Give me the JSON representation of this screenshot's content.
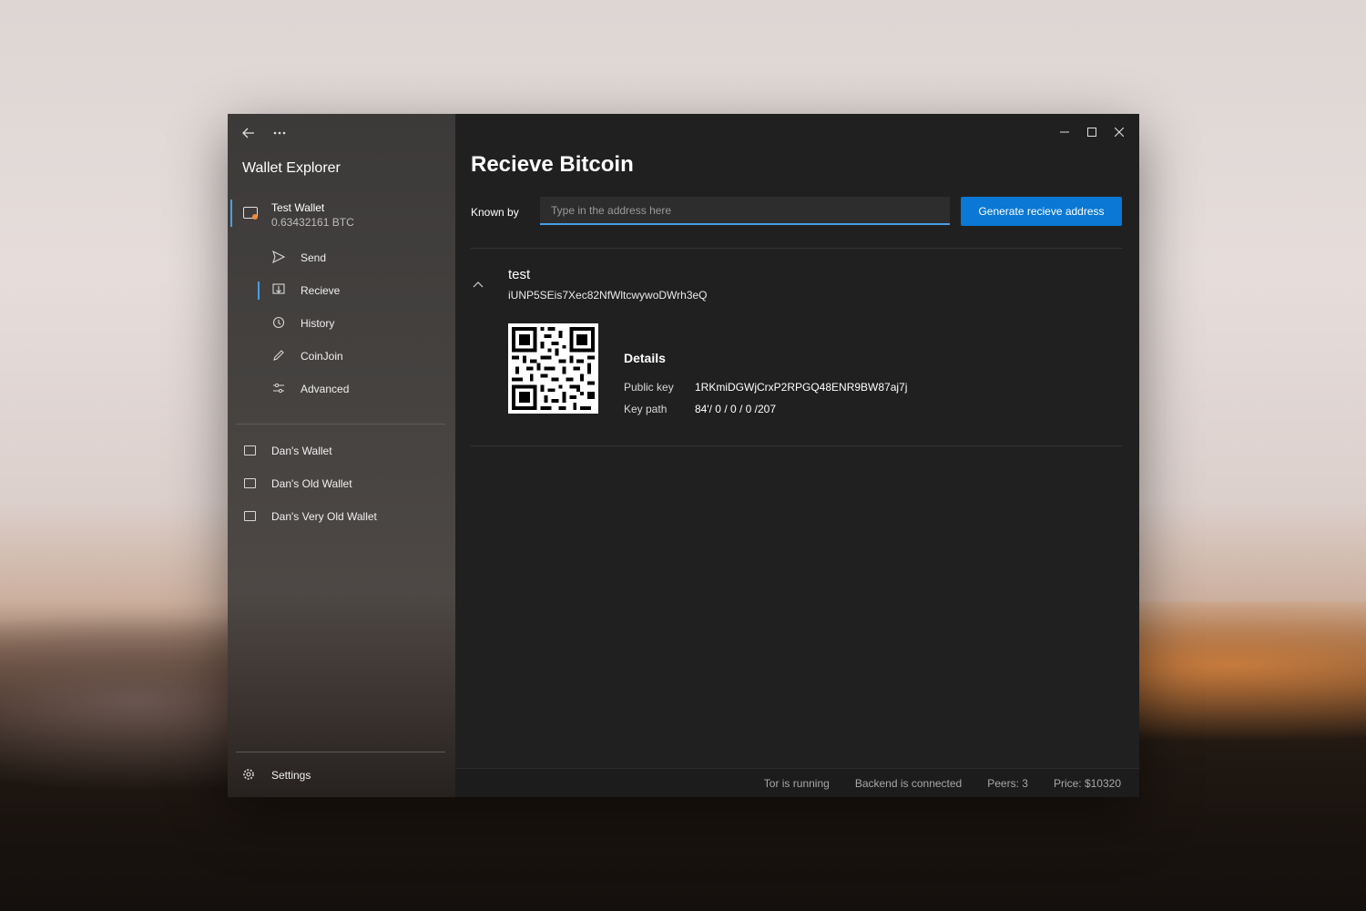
{
  "sidebar": {
    "app_title": "Wallet Explorer",
    "active_wallet": {
      "name": "Test Wallet",
      "balance": "0.63432161 BTC"
    },
    "nav": [
      {
        "label": "Send",
        "icon": "send-icon"
      },
      {
        "label": "Recieve",
        "icon": "receive-icon",
        "active": true
      },
      {
        "label": "History",
        "icon": "history-icon"
      },
      {
        "label": "CoinJoin",
        "icon": "pen-icon"
      },
      {
        "label": "Advanced",
        "icon": "sliders-icon"
      }
    ],
    "wallets": [
      {
        "label": "Dan's Wallet"
      },
      {
        "label": "Dan's Old Wallet"
      },
      {
        "label": "Dan's Very Old Wallet"
      }
    ],
    "settings_label": "Settings"
  },
  "main": {
    "title": "Recieve Bitcoin",
    "known_by_label": "Known by",
    "address_placeholder": "Type in the address here",
    "generate_button": "Generate recieve address",
    "entry": {
      "label": "test",
      "address": "iUNP5SEis7Xec82NfWltcwywoDWrh3eQ",
      "details_title": "Details",
      "public_key_label": "Public key",
      "public_key": "1RKmiDGWjCrxP2RPGQ48ENR9BW87aj7j",
      "key_path_label": "Key path",
      "key_path": "84'/ 0 / 0 / 0 /207"
    }
  },
  "status": {
    "tor": "Tor is running",
    "backend": "Backend is connected",
    "peers": "Peers: 3",
    "price": "Price: $10320"
  },
  "colors": {
    "accent": "#0a78d4",
    "active_indicator": "#4a9fe6",
    "wallet_dot": "#f08a3a"
  }
}
